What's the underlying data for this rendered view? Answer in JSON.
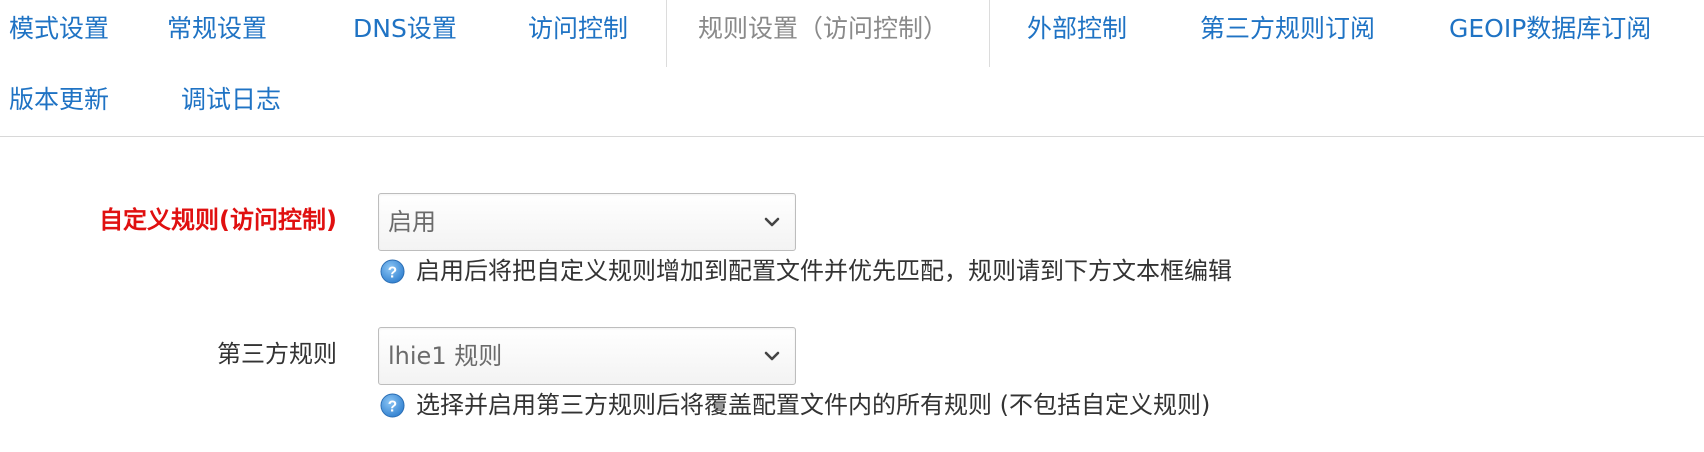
{
  "tabs": [
    {
      "label": "模式设置",
      "active": false
    },
    {
      "label": "常规设置",
      "active": false
    },
    {
      "label": "DNS设置",
      "active": false
    },
    {
      "label": "访问控制",
      "active": false
    },
    {
      "label": "规则设置（访问控制）",
      "active": true
    },
    {
      "label": "外部控制",
      "active": false
    },
    {
      "label": "第三方规则订阅",
      "active": false
    },
    {
      "label": "GEOIP数据库订阅",
      "active": false
    },
    {
      "label": "版本更新",
      "active": false
    },
    {
      "label": "调试日志",
      "active": false
    }
  ],
  "colors": {
    "link": "#1f73c4",
    "active_tab": "#8a8a8a",
    "required_label": "#e01010",
    "text": "#333333",
    "help_icon": "#3a8ed8"
  },
  "form": {
    "custom_rules": {
      "label": "自定义规则(访问控制)",
      "selected": "启用",
      "hint": "启用后将把自定义规则增加到配置文件并优先匹配，规则请到下方文本框编辑",
      "icon": "help-icon"
    },
    "third_party_rules": {
      "label": "第三方规则",
      "selected": "lhie1 规则",
      "hint": "选择并启用第三方规则后将覆盖配置文件内的所有规则 (不包括自定义规则)",
      "icon": "help-icon"
    }
  }
}
